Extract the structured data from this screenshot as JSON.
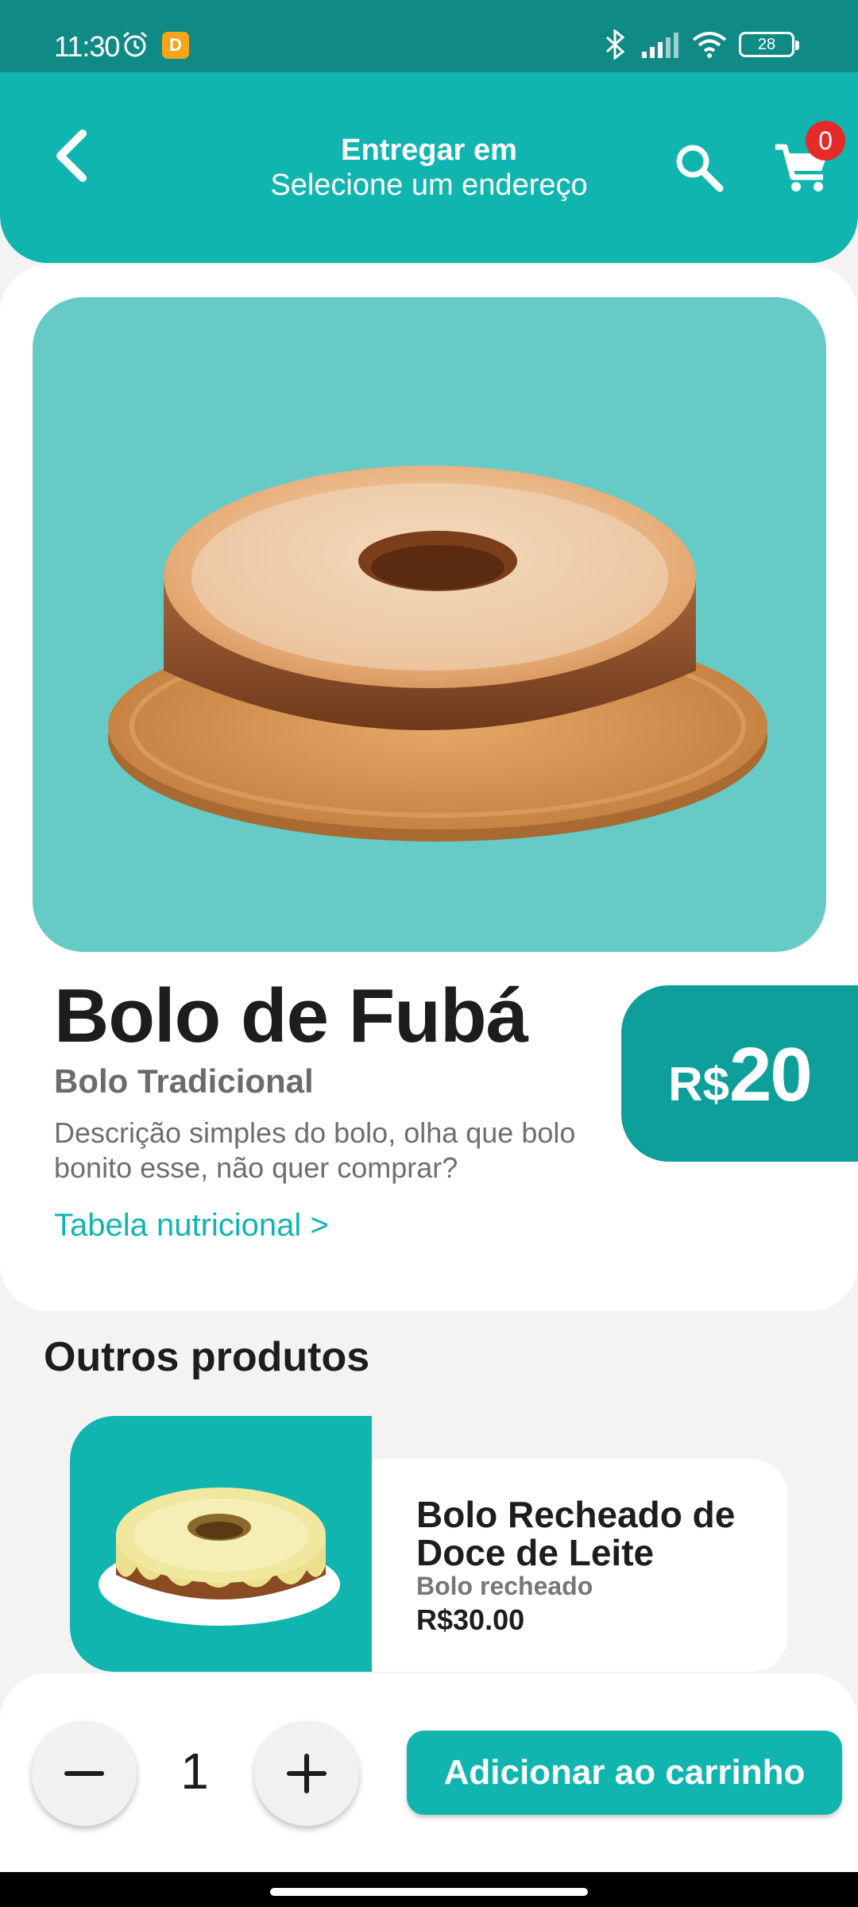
{
  "status_bar": {
    "time": "11:30",
    "app_icon_letter": "D",
    "battery": "28"
  },
  "header": {
    "title": "Entregar em",
    "subtitle": "Selecione um endereço",
    "cart_count": "0"
  },
  "product": {
    "name": "Bolo de Fubá",
    "category": "Bolo Tradicional",
    "description": "Descrição simples do bolo, olha que bolo bonito esse, não quer comprar?",
    "nutrition_link": "Tabela nutricional >",
    "price_currency": "R$",
    "price_value": "20"
  },
  "other_products": {
    "title": "Outros produtos",
    "items": [
      {
        "name": "Bolo Recheado de Doce de Leite",
        "category": "Bolo recheado",
        "price": "R$30.00"
      }
    ]
  },
  "bottom_bar": {
    "quantity": "1",
    "add_to_cart": "Adicionar ao carrinho"
  },
  "colors": {
    "primary": "#10b5b0",
    "primary_dark": "#0f9f9b",
    "status_bar": "#0f8a85",
    "hero_bg": "#66cbc6",
    "badge": "#e62a2a"
  }
}
